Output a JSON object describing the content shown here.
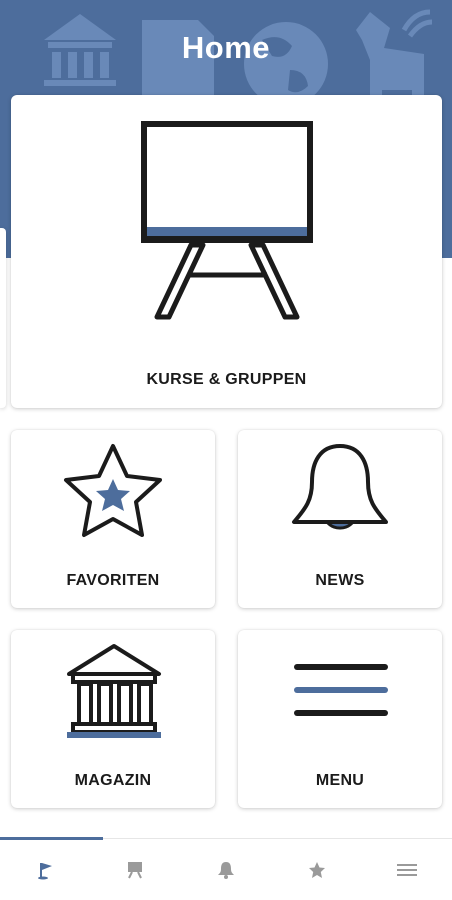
{
  "header": {
    "title": "Home",
    "background_color": "#4d6d9c",
    "decor_icons": [
      "bank-icon",
      "document-icon",
      "globe-icon",
      "horse-icon"
    ]
  },
  "tiles": [
    {
      "id": "courses",
      "label": "KURSE & GRUPPEN",
      "icon": "easel-icon"
    },
    {
      "id": "favorites",
      "label": "FAVORITEN",
      "icon": "star-icon"
    },
    {
      "id": "news",
      "label": "NEWS",
      "icon": "bell-icon"
    },
    {
      "id": "magazine",
      "label": "MAGAZIN",
      "icon": "bank-icon"
    },
    {
      "id": "menu",
      "label": "MENU",
      "icon": "hamburger-icon"
    }
  ],
  "bottom_nav": {
    "items": [
      {
        "icon": "flag-icon",
        "active": true
      },
      {
        "icon": "easel-icon",
        "active": false
      },
      {
        "icon": "bell-icon",
        "active": false
      },
      {
        "icon": "star-icon",
        "active": false
      },
      {
        "icon": "menu-icon",
        "active": false
      }
    ],
    "active_color": "#4d6d9c",
    "inactive_color": "#9a9a9a"
  },
  "colors": {
    "accent": "#4d6d9c",
    "icon_stroke": "#1b1b1b"
  }
}
